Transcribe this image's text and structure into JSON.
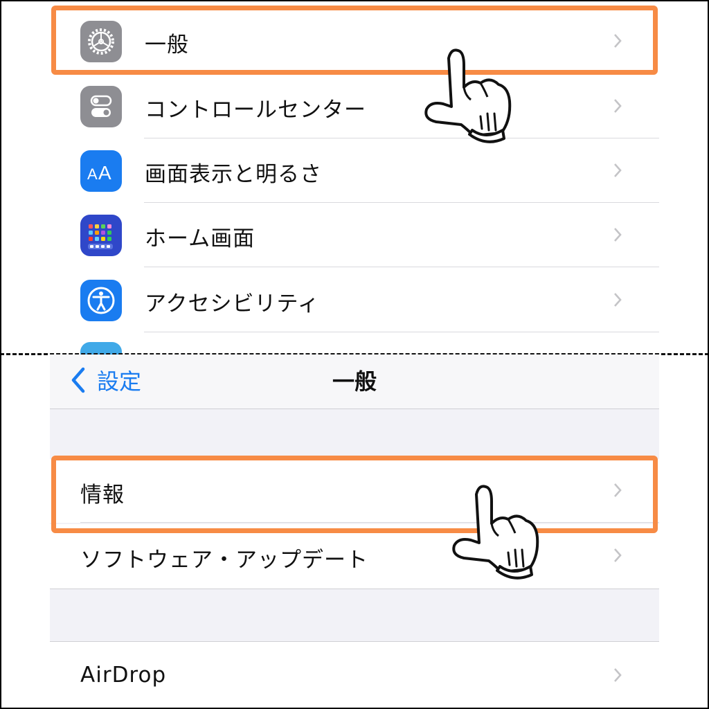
{
  "settings_list": {
    "items": [
      {
        "label": "一般",
        "icon": "gear-icon"
      },
      {
        "label": "コントロールセンター",
        "icon": "toggle-switches-icon"
      },
      {
        "label": "画面表示と明るさ",
        "icon": "text-size-aa-icon"
      },
      {
        "label": "ホーム画面",
        "icon": "home-screen-grid-icon"
      },
      {
        "label": "アクセシビリティ",
        "icon": "accessibility-person-icon"
      }
    ]
  },
  "general_screen": {
    "back_label": "設定",
    "title": "一般",
    "items": [
      {
        "label": "情報"
      },
      {
        "label": "ソフトウェア・アップデート"
      },
      {
        "label": "AirDrop"
      }
    ]
  },
  "annotations": {
    "highlight_color": "#f78b45",
    "pointer": "pointing-hand-icon"
  },
  "colors": {
    "ios_blue": "#1a7cf0",
    "gear_gray": "#8e8e93",
    "grouped_background": "#f2f2f7"
  }
}
